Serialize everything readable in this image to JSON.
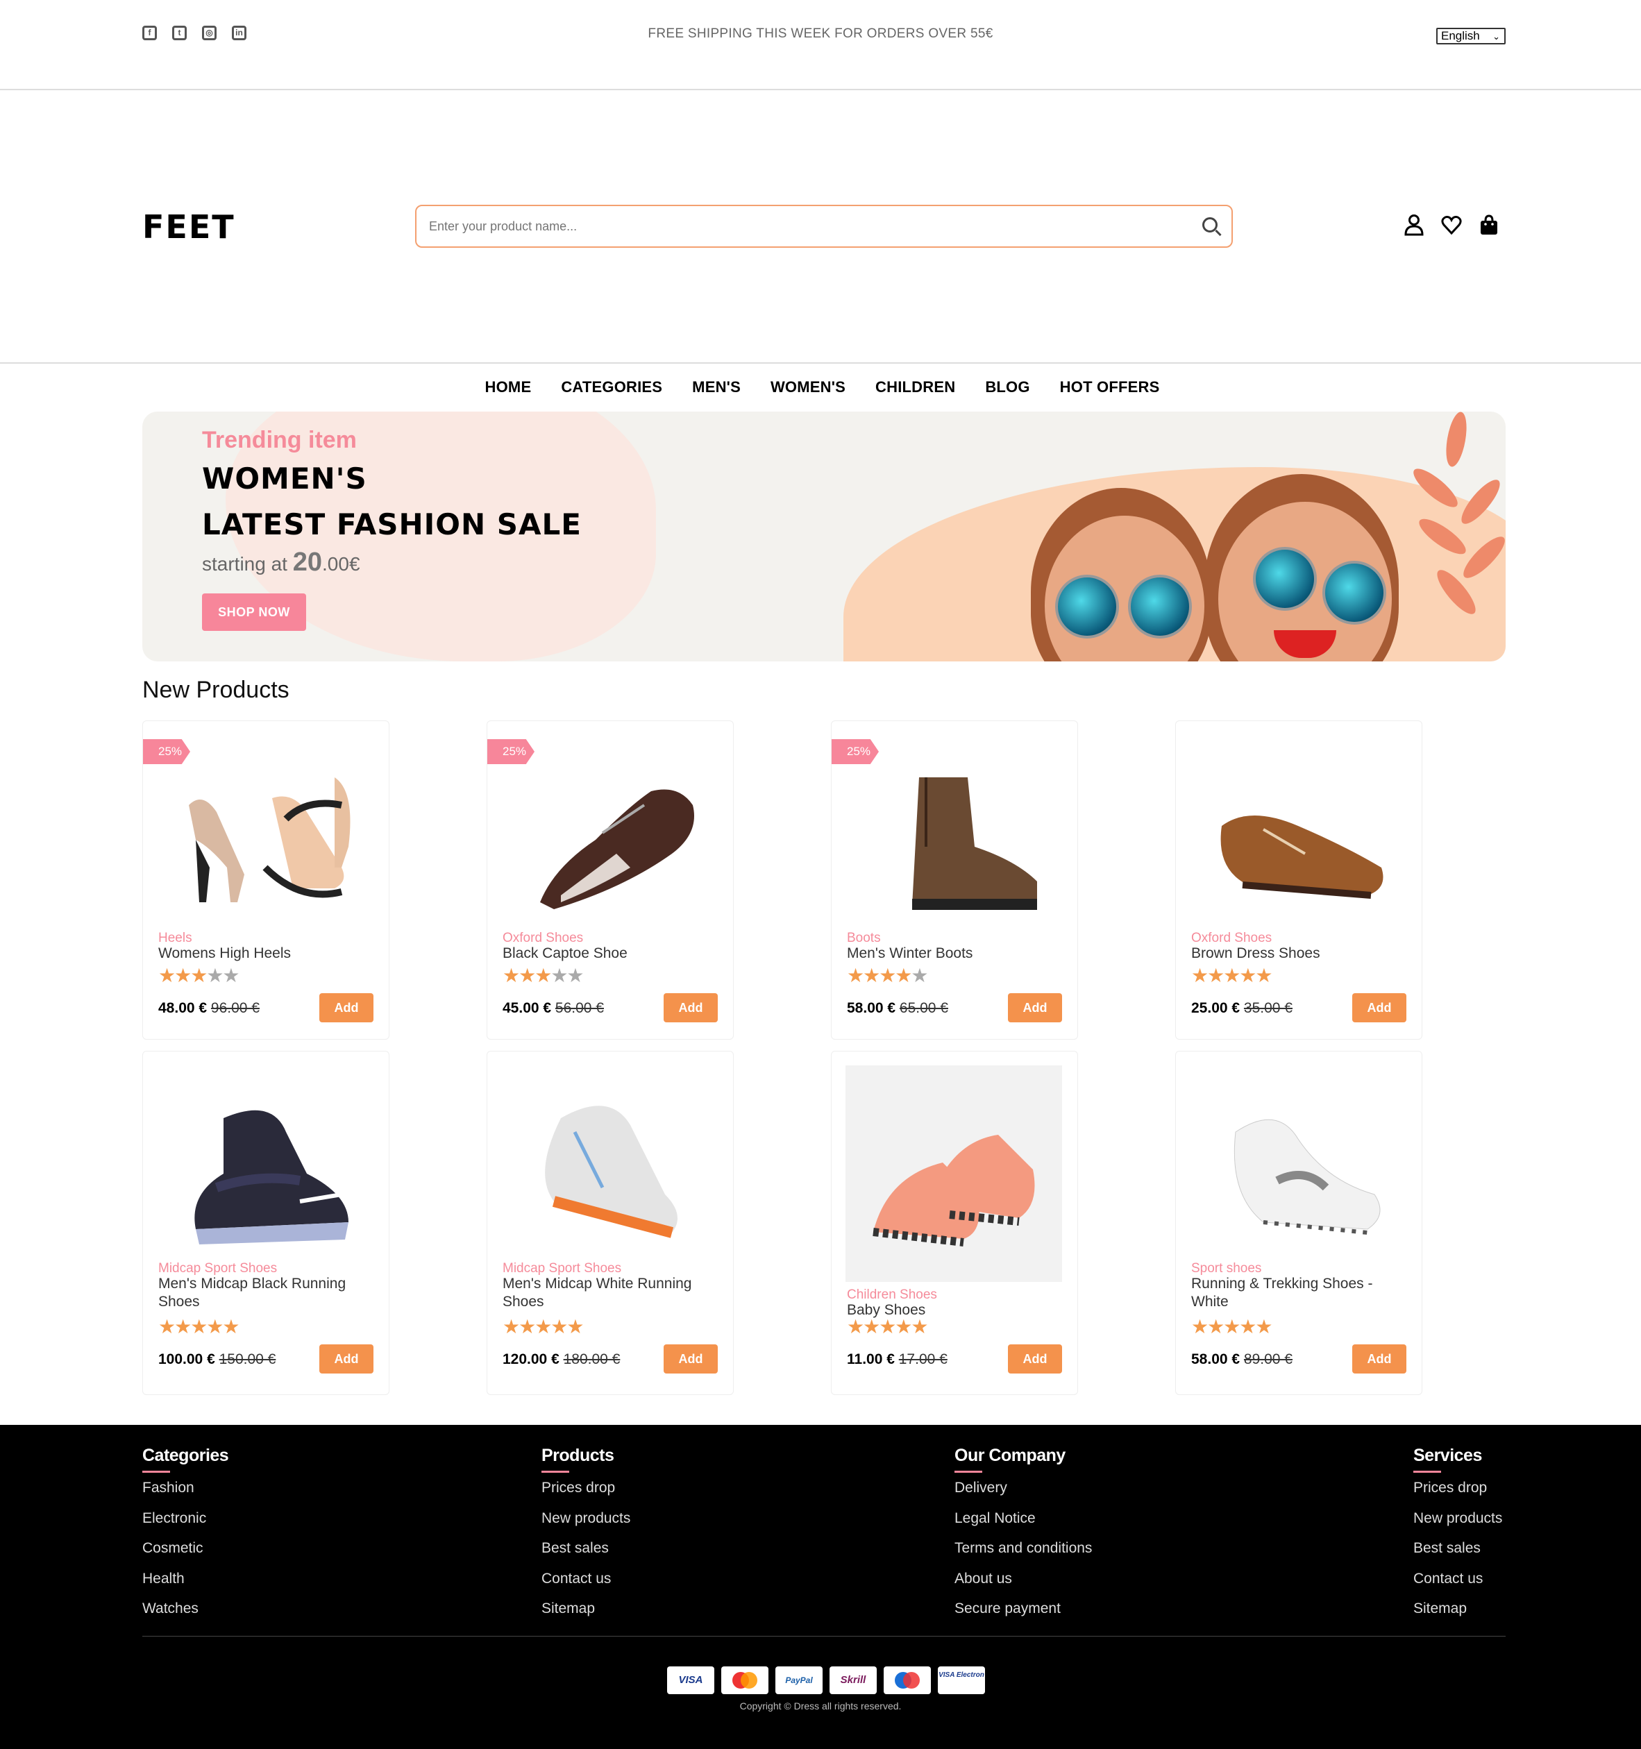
{
  "topbar": {
    "social": [
      {
        "icon": "facebook-icon",
        "glyph": "f"
      },
      {
        "icon": "twitter-icon",
        "glyph": "t"
      },
      {
        "icon": "instagram-icon",
        "glyph": "◎"
      },
      {
        "icon": "linkedin-icon",
        "glyph": "in"
      }
    ],
    "shipping": "FREE SHIPPING THIS WEEK FOR ORDERS OVER 55€",
    "language": "English"
  },
  "header": {
    "logo": "FEET",
    "search_placeholder": "Enter your product name...",
    "icons": [
      "user-icon",
      "heart-icon",
      "bag-icon"
    ]
  },
  "nav": [
    "HOME",
    "CATEGORIES",
    "MEN'S",
    "WOMEN'S",
    "CHILDREN",
    "BLOG",
    "HOT OFFERS"
  ],
  "banner": {
    "subtitle": "Trending item",
    "title_line1": "WOMEN'S",
    "title_line2": "LATEST FASHION SALE",
    "starting_prefix": "starting at ",
    "price_big": "20",
    "price_small": ".00€",
    "button": "SHOP NOW"
  },
  "section_title": "New Products",
  "products": [
    {
      "badge": "25%",
      "category": "Heels",
      "name": "Womens High Heels",
      "rating": 3,
      "price": "48.00 €",
      "old_price": "96.00 €",
      "add": "Add"
    },
    {
      "badge": "25%",
      "category": "Oxford Shoes",
      "name": "Black Captoe Shoe",
      "rating": 3,
      "price": "45.00 €",
      "old_price": "56.00 €",
      "add": "Add"
    },
    {
      "badge": "25%",
      "category": "Boots",
      "name": "Men's Winter Boots",
      "rating": 4,
      "price": "58.00 €",
      "old_price": "65.00 €",
      "add": "Add"
    },
    {
      "badge": "",
      "category": "Oxford Shoes",
      "name": "Brown Dress Shoes",
      "rating": 5,
      "price": "25.00 €",
      "old_price": "35.00 €",
      "add": "Add"
    },
    {
      "badge": "",
      "category": "Midcap Sport Shoes",
      "name": "Men's Midcap Black Running Shoes",
      "rating": 5,
      "price": "100.00 €",
      "old_price": "150.00 €",
      "add": "Add"
    },
    {
      "badge": "",
      "category": "Midcap Sport Shoes",
      "name": "Men's Midcap White Running Shoes",
      "rating": 5,
      "price": "120.00 €",
      "old_price": "180.00 €",
      "add": "Add"
    },
    {
      "badge": "",
      "category": "Children Shoes",
      "name": "Baby Shoes",
      "rating": 5,
      "price": "11.00 €",
      "old_price": "17.00 €",
      "add": "Add"
    },
    {
      "badge": "",
      "category": "Sport shoes",
      "name": "Running & Trekking Shoes - White",
      "rating": 5,
      "price": "58.00 €",
      "old_price": "89.00 €",
      "add": "Add"
    }
  ],
  "footer": {
    "columns": [
      {
        "title": "Categories",
        "items": [
          "Fashion",
          "Electronic",
          "Cosmetic",
          "Health",
          "Watches"
        ]
      },
      {
        "title": "Products",
        "items": [
          "Prices drop",
          "New products",
          "Best sales",
          "Contact us",
          "Sitemap"
        ]
      },
      {
        "title": "Our Company",
        "items": [
          "Delivery",
          "Legal Notice",
          "Terms and conditions",
          "About us",
          "Secure payment"
        ]
      },
      {
        "title": "Services",
        "items": [
          "Prices drop",
          "New products",
          "Best sales",
          "Contact us",
          "Sitemap"
        ]
      }
    ],
    "payments": [
      "VISA",
      "Mastercard",
      "PayPal",
      "Skrill",
      "Maestro",
      "VISA Electron"
    ],
    "copyright": "Copyright © Dress all rights reserved."
  },
  "colors": {
    "accent": "#f7869a",
    "button": "#f4924c",
    "star": "#f39a4a"
  }
}
